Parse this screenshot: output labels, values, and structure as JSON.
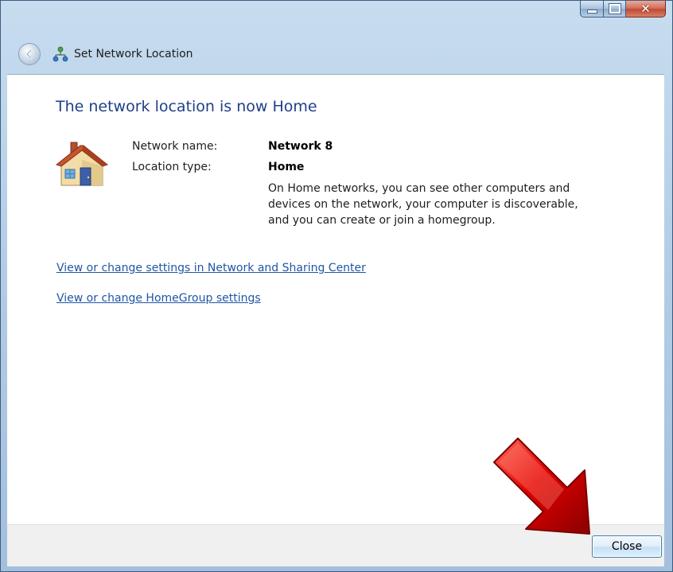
{
  "window": {
    "title": "Set Network Location"
  },
  "caption": {
    "minimize_icon": "minimize-icon",
    "maximize_icon": "maximize-icon",
    "close_icon": "close-icon",
    "close_glyph": "✕"
  },
  "nav": {
    "back_icon": "back-arrow-icon",
    "network_icon": "network-icon"
  },
  "content": {
    "heading": "The network location is now Home",
    "house_icon": "home-icon",
    "network_name_label": "Network name:",
    "network_name_value": "Network  8",
    "location_type_label": "Location type:",
    "location_type_value": "Home",
    "description": "On Home networks, you can see other computers and devices on the network, your computer is discoverable, and you can create or join a homegroup.",
    "links": {
      "network_sharing": "View or change settings in Network and Sharing Center",
      "homegroup": "View or change HomeGroup settings"
    }
  },
  "footer": {
    "close_label": "Close"
  },
  "overlay": {
    "arrow_icon": "red-arrow-icon",
    "arrow_color": "#c80000"
  },
  "colors": {
    "heading": "#1f3f8a",
    "link": "#1f56a6",
    "title_bar": "#b4cde6",
    "close_caption": "#c14a32"
  }
}
